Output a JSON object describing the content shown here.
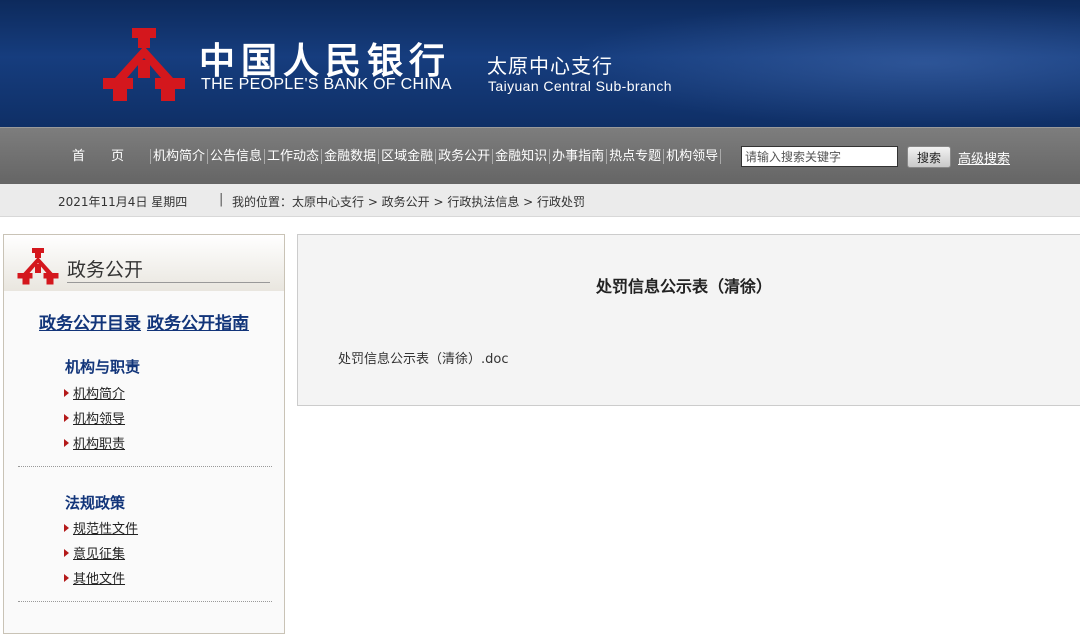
{
  "header": {
    "bank_name_cn": "中国人民银行",
    "bank_name_en": "THE PEOPLE'S BANK OF CHINA",
    "branch_cn": "太原中心支行",
    "branch_en": "Taiyuan  Central  Sub-branch",
    "logo_icon": "pboc-emblem-icon",
    "colors": {
      "banner": "#163d7e",
      "emblem": "#d4171d"
    }
  },
  "nav": {
    "items": [
      "首页",
      "机构简介",
      "公告信息",
      "工作动态",
      "金融数据",
      "区域金融",
      "政务公开",
      "金融知识",
      "办事指南",
      "热点专题",
      "机构领导"
    ],
    "search_placeholder": "请输入搜索关键字",
    "search_button": "搜索",
    "advanced_search": "高级搜索"
  },
  "breadcrumb": {
    "date": "2021年11月4日  星期四",
    "separator": "|",
    "location": "我的位置：太原中心支行 > 政务公开 > 行政执法信息 > 行政处罚"
  },
  "sidebar": {
    "title": "政务公开",
    "links": [
      "政务公开目录",
      "政务公开指南"
    ],
    "sections": [
      {
        "title": "机构与职责",
        "items": [
          "机构简介",
          "机构领导",
          "机构职责"
        ]
      },
      {
        "title": "法规政策",
        "items": [
          "规范性文件",
          "意见征集",
          "其他文件"
        ]
      }
    ]
  },
  "content": {
    "title": "处罚信息公示表（清徐）",
    "attachment": "处罚信息公示表（清徐）.doc"
  }
}
